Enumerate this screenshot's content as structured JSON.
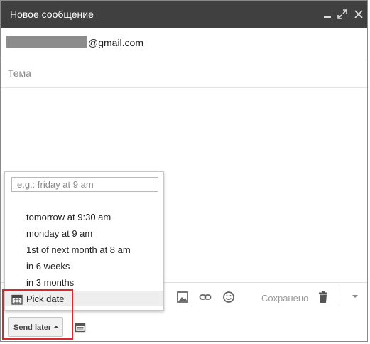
{
  "window": {
    "title": "Новое сообщение",
    "titlebar_color": "#404040"
  },
  "compose": {
    "to_suffix": "@gmail.com",
    "subject_placeholder": "Тема",
    "saved_label": "Сохранено"
  },
  "send_later": {
    "button_label": "Send later",
    "input_placeholder": "e.g.: friday at 9 am",
    "options": [
      "tomorrow at 9:30 am",
      "monday at 9 am",
      "1st of next month at 8 am",
      "in 6 weeks",
      "in 3 months"
    ],
    "pick_date_label": "Pick date"
  },
  "highlight_color": "#d9272e"
}
